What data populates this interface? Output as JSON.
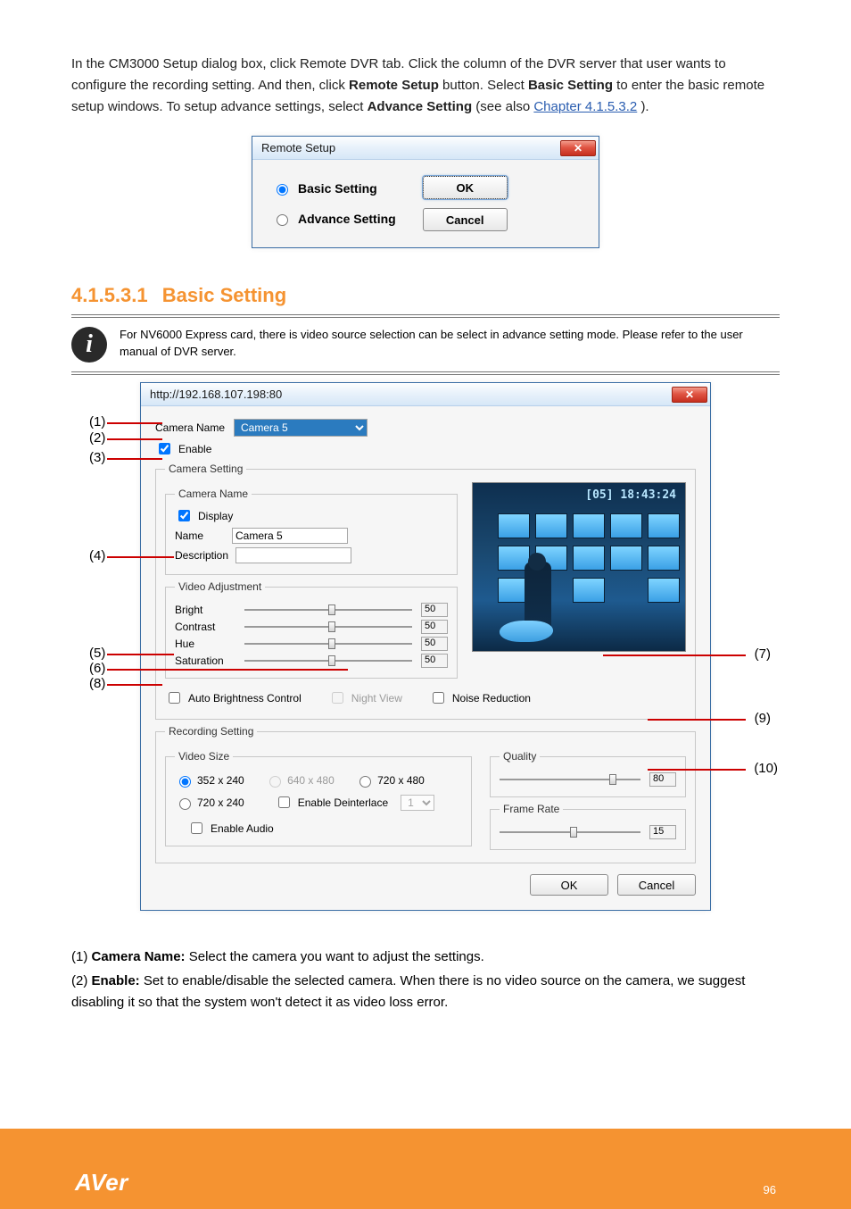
{
  "intro": {
    "line1": "In the CM3000 Setup dialog box, click Remote DVR tab. Click the column of the DVR server that user wants to configure the recording setting. And then, click ",
    "line1_bold": "Remote Setup",
    "line1_tail": " button. Select ",
    "line1_bold2": "Basic Setting",
    "line1_tail2": " to enter the basic remote setup windows. To setup advance settings, select ",
    "line1_bold3": "Advance Setting",
    "line1_tail3": " (see also ",
    "line1_link": "Chapter 4.1.5.3.2",
    "line1_tail4": ")."
  },
  "remote_setup": {
    "title": "Remote Setup",
    "basic_label": "Basic Setting",
    "advance_label": "Advance Setting",
    "ok": "OK",
    "cancel": "Cancel"
  },
  "heading": {
    "num": "4.1.5.3.1",
    "title": "Basic Setting"
  },
  "info": "For NV6000 Express card, there is video source selection can be select in advance setting mode. Please refer to the user manual of DVR server.",
  "dialog2": {
    "title": "http://192.168.107.198:80",
    "camera_name_label": "Camera Name",
    "camera_selected": "Camera 5",
    "enable_label": "Enable",
    "camera_setting_legend": "Camera Setting",
    "camera_name_group": "Camera Name",
    "display_label": "Display",
    "name_label": "Name",
    "name_value": "Camera 5",
    "description_label": "Description",
    "description_value": "",
    "video_adj_legend": "Video Adjustment",
    "bright_label": "Bright",
    "bright_val": "50",
    "contrast_label": "Contrast",
    "contrast_val": "50",
    "hue_label": "Hue",
    "hue_val": "50",
    "sat_label": "Saturation",
    "sat_val": "50",
    "auto_bright_label": "Auto Brightness Control",
    "night_view_label": "Night View",
    "noise_red_label": "Noise Reduction",
    "rec_setting_legend": "Recording Setting",
    "video_size_legend": "Video Size",
    "size_352": "352 x 240",
    "size_640": "640 x 480",
    "size_720_480": "720 x 480",
    "size_720_240": "720 x 240",
    "deint_label": "Enable Deinterlace",
    "deint_sel": "1",
    "enable_audio_label": "Enable Audio",
    "quality_legend": "Quality",
    "quality_val": "80",
    "frame_rate_legend": "Frame Rate",
    "frame_rate_val": "15",
    "ok": "OK",
    "cancel": "Cancel",
    "preview_overlay": "[05] 18:43:24"
  },
  "callouts": {
    "c1": "(1)",
    "c2": "(2)",
    "c3": "(3)",
    "c4": "(4)",
    "c5": "(5)",
    "c6": "(6)",
    "c7": "(7)",
    "c8": "(8)",
    "c9": "(9)",
    "c10": "(10)"
  },
  "descriptions": {
    "d1_num": "(1) ",
    "d1_lbl": "Camera Name:",
    "d1_txt": " Select the camera you want to adjust the settings.",
    "d2_num": "(2) ",
    "d2_lbl": "Enable:",
    "d2_txt": " Set to enable/disable the selected camera. When there is no video source on the camera, we suggest disabling it so that the system won't detect it as video loss error."
  },
  "footer": {
    "logo": "AVer",
    "page": "96"
  }
}
